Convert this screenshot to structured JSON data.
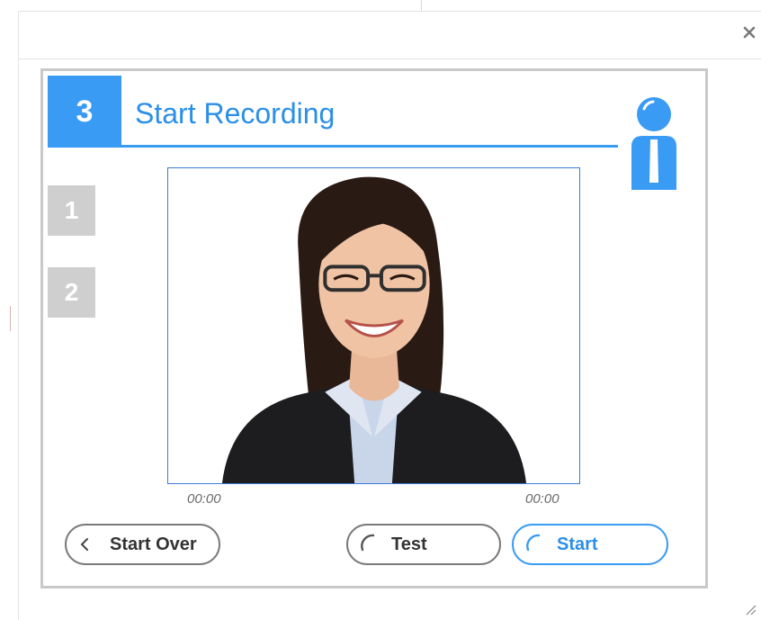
{
  "dialog": {
    "close_label": "x"
  },
  "wizard": {
    "active_step": "3",
    "title": "Start Recording",
    "steps": [
      {
        "number": "1"
      },
      {
        "number": "2"
      }
    ]
  },
  "video": {
    "elapsed": "00:00",
    "duration": "00:00"
  },
  "buttons": {
    "start_over": "Start Over",
    "test": "Test",
    "start": "Start"
  },
  "icons": {
    "info": "info-person-icon",
    "close": "close-icon",
    "back": "chevron-left-icon",
    "spinner": "loading-spinner-icon",
    "resize": "resize-grip-icon"
  },
  "colors": {
    "accent": "#3a9bf4",
    "accent_text": "#2b8fe8",
    "inactive_step": "#cfcfcf",
    "panel_border": "#c9c9c9",
    "button_border": "#7a7a7a"
  }
}
